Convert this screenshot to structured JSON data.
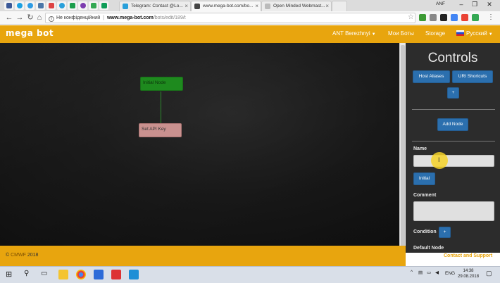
{
  "browser": {
    "tabs": [
      {
        "title": "Telegram: Contact @Lo..."
      },
      {
        "title": "www.mega-bot.com/bo..."
      },
      {
        "title": "Open Minded Webmast..."
      }
    ],
    "profile_name": "ANF",
    "url": {
      "security_label": "Не конфіденційний",
      "host": "www.mega-bot.com",
      "path": "/bots/edit/189/t"
    }
  },
  "site": {
    "logo_text": "mega bot",
    "nav": {
      "user_menu": "ANT Berezhnyi",
      "my_bots": "Мои Боты",
      "storage": "Storage",
      "language": "Русский"
    },
    "footer": {
      "copyright_symbol": "©",
      "company": "CMWF",
      "year": "2018",
      "contact_link": "Contact and Support"
    }
  },
  "canvas": {
    "nodes": [
      {
        "label": "Initial Node"
      },
      {
        "label": "Set API Key"
      }
    ]
  },
  "controls": {
    "title": "Controls",
    "host_aliases_button": "Host Aliases",
    "url_shortcuts_button": "URI Shortcuts",
    "plus_label": "+",
    "add_node_button": "Add Node",
    "name_label": "Name",
    "name_value": "",
    "initial_button": "Initial",
    "comment_label": "Comment",
    "comment_value": "",
    "condition_label": "Condition",
    "condition_add": "+",
    "default_node_label": "Default Node"
  },
  "taskbar": {
    "language": "ENG",
    "time": "14:38",
    "date": "29.08.2018"
  },
  "colors": {
    "brand_orange": "#e8a50e",
    "button_blue": "#2b6fae",
    "initial_node_green": "#1e8a1e",
    "set_api_node_pink": "#c9918f",
    "panel_bg": "#2c2c2c"
  }
}
